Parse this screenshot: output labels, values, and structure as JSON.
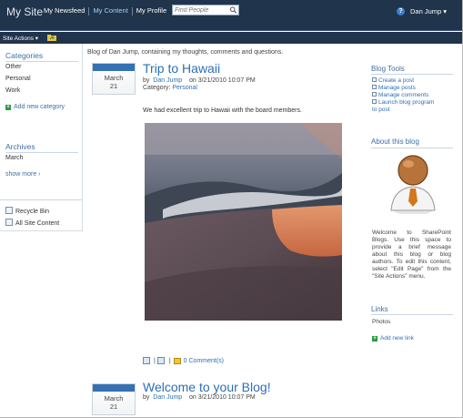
{
  "header": {
    "site_title": "My Site",
    "nav": [
      "My Newsfeed",
      "My Content",
      "My Profile"
    ],
    "search_placeholder": "Find People",
    "help_label": "?",
    "user": "Dan Jump ▾",
    "site_actions": "Site Actions ▾"
  },
  "leftnav": {
    "categories_heading": "Categories",
    "categories": [
      "Other",
      "Personal",
      "Work"
    ],
    "add_category": "Add new category",
    "archives_heading": "Archives",
    "archives": [
      "March"
    ],
    "show_more": "show more ›",
    "recycle_bin": "Recycle Bin",
    "all_site_content": "All Site Content"
  },
  "blog": {
    "description": "Blog of Dan Jump, containing my thoughts, comments and questions.",
    "posts": [
      {
        "month": "March",
        "day": "21",
        "title": "Trip to Hawaii",
        "by": "by",
        "author": "Dan Jump",
        "date": "on 3/21/2010 10:07 PM",
        "category_label": "Category:",
        "category": "Personal",
        "body": "We had excellent trip to Hawaii with the board members.",
        "comments": "0 Comment(s)"
      },
      {
        "month": "March",
        "day": "21",
        "title": "Welcome to your Blog!",
        "by": "by",
        "author": "Dan Jump",
        "date": "on 3/21/2010 10:07 PM"
      }
    ]
  },
  "right": {
    "blog_tools_heading": "Blog Tools",
    "tools": [
      "Create a post",
      "Manage posts",
      "Manage comments",
      "Launch blog program",
      "to post"
    ],
    "about_heading": "About this blog",
    "about_text": "Welcome to SharePoint Blogs. Use this space to provide a brief message about this blog or blog authors. To edit this content, select \"Edit Page\" from the \"Site Actions\" menu.",
    "links_heading": "Links",
    "links": [
      "Photos"
    ],
    "add_link": "Add new link"
  }
}
